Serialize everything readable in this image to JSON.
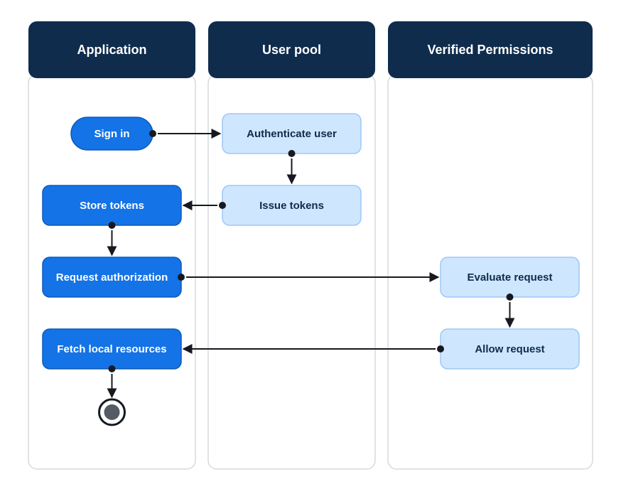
{
  "lanes": {
    "application": {
      "title": "Application"
    },
    "userpool": {
      "title": "User pool"
    },
    "verified": {
      "title": "Verified Permissions"
    }
  },
  "nodes": {
    "sign_in": "Sign in",
    "authenticate_user": "Authenticate user",
    "issue_tokens": "Issue tokens",
    "store_tokens": "Store tokens",
    "request_authorization": "Request authorization",
    "evaluate_request": "Evaluate request",
    "allow_request": "Allow request",
    "fetch_local_resources": "Fetch local resources"
  }
}
